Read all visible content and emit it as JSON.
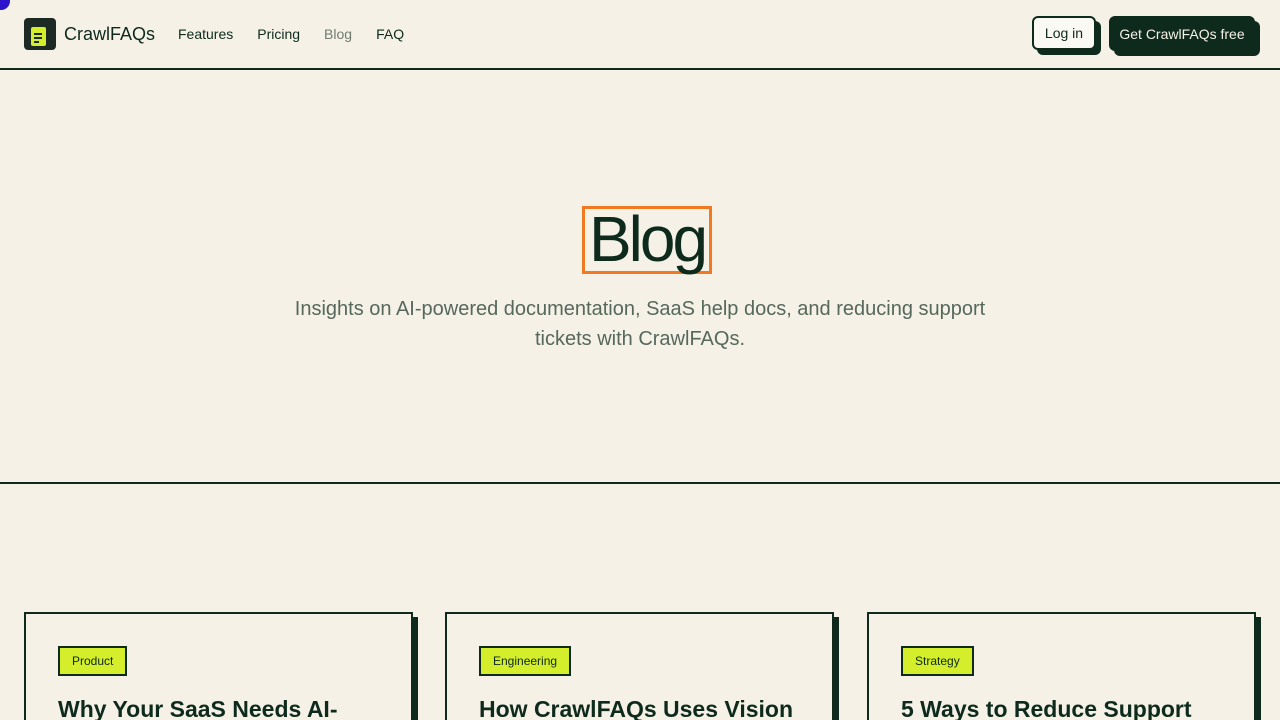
{
  "brand": {
    "name": "CrawlFAQs",
    "logo_icon": "document-icon",
    "accent": "#d4ee2c",
    "dark": "#0d2a1c",
    "highlight": "#f07a22"
  },
  "nav": [
    {
      "label": "Features"
    },
    {
      "label": "Pricing"
    },
    {
      "label": "Blog",
      "active": true
    },
    {
      "label": "FAQ"
    }
  ],
  "actions": {
    "login": "Log in",
    "cta": "Get CrawlFAQs free"
  },
  "hero": {
    "title": "Blog",
    "subtitle": "Insights on AI-powered documentation, SaaS help docs, and reducing support tickets with CrawlFAQs."
  },
  "posts": [
    {
      "category": "Product",
      "title": "Why Your SaaS Needs AI-"
    },
    {
      "category": "Engineering",
      "title": "How CrawlFAQs Uses Vision AI"
    },
    {
      "category": "Strategy",
      "title": "5 Ways to Reduce Support"
    }
  ]
}
